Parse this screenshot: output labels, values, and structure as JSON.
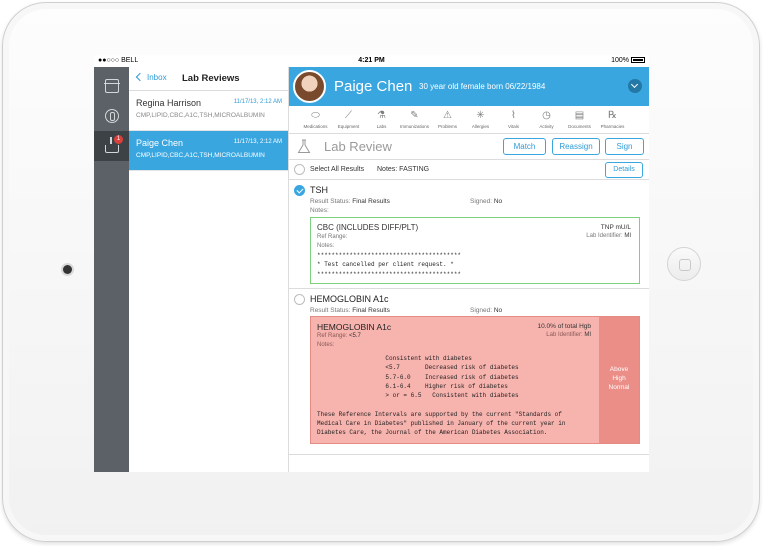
{
  "status_bar": {
    "carrier": "BELL",
    "time": "4:21 PM",
    "battery": "100%"
  },
  "rail": {
    "badge": "1"
  },
  "list": {
    "back_label": "Inbox",
    "title": "Lab Reviews",
    "items": [
      {
        "name": "Regina Harrison",
        "date": "11/17/13, 2:12 AM",
        "tests": "CMP,LIPID,CBC,A1C,TSH,MICROALBUMIN"
      },
      {
        "name": "Paige Chen",
        "date": "11/17/13, 2:12 AM",
        "tests": "CMP,LIPID,CBC,A1C,TSH,MICROALBUMIN"
      }
    ]
  },
  "patient": {
    "name": "Paige Chen",
    "info": "30 year old female born 06/22/1984"
  },
  "toolbar": [
    {
      "label": "Medications",
      "icon": "pill-icon"
    },
    {
      "label": "Equipment",
      "icon": "syringe-icon"
    },
    {
      "label": "Labs",
      "icon": "flask-icon"
    },
    {
      "label": "Immunizations",
      "icon": "needle-icon"
    },
    {
      "label": "Problems",
      "icon": "warning-icon"
    },
    {
      "label": "Allergies",
      "icon": "snowflake-icon"
    },
    {
      "label": "Vitals",
      "icon": "pulse-icon"
    },
    {
      "label": "Activity",
      "icon": "clock-icon"
    },
    {
      "label": "Documents",
      "icon": "document-icon"
    },
    {
      "label": "Pharmacies",
      "icon": "rx-icon"
    }
  ],
  "review": {
    "title": "Lab Review",
    "match_label": "Match",
    "reassign_label": "Reassign",
    "sign_label": "Sign",
    "select_all": "Select All Results",
    "notes": "Notes: FASTING",
    "details_label": "Details"
  },
  "results": [
    {
      "name": "TSH",
      "status_label": "Result Status:",
      "status": "Final Results",
      "signed_label": "Signed:",
      "signed": "No",
      "notes_label": "Notes:",
      "card": {
        "title": "CBC (INCLUDES DIFF/PLT)",
        "value": "TNP mU/L",
        "lab_id_label": "Lab Identifier:",
        "lab_id": "MI",
        "ref_range_label": "Ref Range:",
        "notes_label": "Notes:",
        "notes_text": "****************************************\n* Test cancelled per client request. *\n****************************************"
      }
    },
    {
      "name": "HEMOGLOBIN A1c",
      "status_label": "Result Status:",
      "status": "Final Results",
      "signed_label": "Signed:",
      "signed": "No",
      "card": {
        "title": "HEMOGLOBIN A1c",
        "value": "10.0% of total Hgb",
        "lab_id_label": "Lab Identifier:",
        "lab_id": "MI",
        "ref_range_label": "Ref Range:",
        "ref_range": "<5.7",
        "notes_label": "Notes:",
        "notes_text": "                   Consistent with diabetes\n                   <5.7       Decreased risk of diabetes\n                   5.7-6.0    Increased risk of diabetes\n                   6.1-6.4    Higher risk of diabetes\n                   > or = 6.5   Consistent with diabetes\n\nThese Reference Intervals are supported by the current \"Standards of\nMedical Care in Diabetes\" published in January of the current year in\nDiabetes Care, the Journal of the American Diabetes Association.",
        "flag": "Above\nHigh\nNormal",
        "flag_color": "#eb8e88"
      }
    }
  ],
  "colors": {
    "accent": "#3aa6e0",
    "rail": "#5b6166",
    "normal_border": "#7ed07e",
    "abnormal_bg": "#f7b3ae"
  }
}
